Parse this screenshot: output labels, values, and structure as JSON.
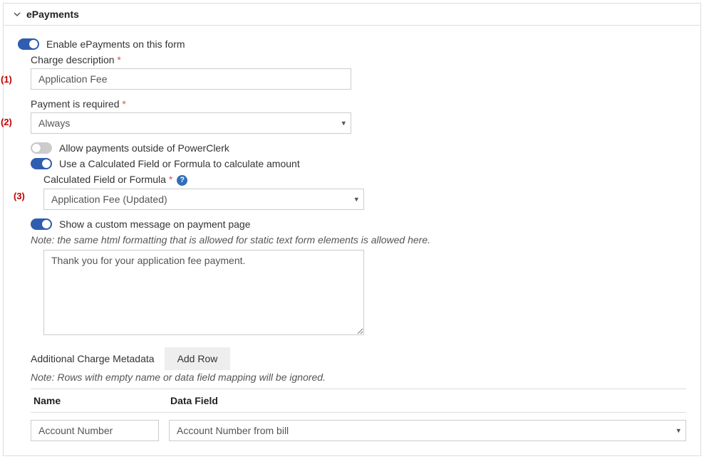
{
  "panel": {
    "title": "ePayments"
  },
  "annotations": {
    "a1": "(1)",
    "a2": "(2)",
    "a3": "(3)"
  },
  "toggles": {
    "enable_label": "Enable ePayments on this form",
    "allow_outside_label": "Allow payments outside of PowerClerk",
    "use_calc_label": "Use a Calculated Field or Formula to calculate amount",
    "show_custom_label": "Show a custom message on payment page"
  },
  "charge_desc": {
    "label": "Charge description",
    "value": "Application Fee"
  },
  "payment_required": {
    "label": "Payment is required",
    "value": "Always"
  },
  "calc_field": {
    "label": "Calculated Field or Formula",
    "value": "Application Fee (Updated)"
  },
  "custom_message": {
    "note": "Note: the same html formatting that is allowed for static text form elements is allowed here.",
    "value": "Thank you for your application fee payment."
  },
  "metadata": {
    "label": "Additional Charge Metadata",
    "add_row": "Add Row",
    "note": "Note: Rows with empty name or data field mapping will be ignored.",
    "col_name": "Name",
    "col_data": "Data Field",
    "row": {
      "name": "Account Number",
      "data": "Account Number from bill"
    }
  },
  "required_marker": "*",
  "help_glyph": "?"
}
